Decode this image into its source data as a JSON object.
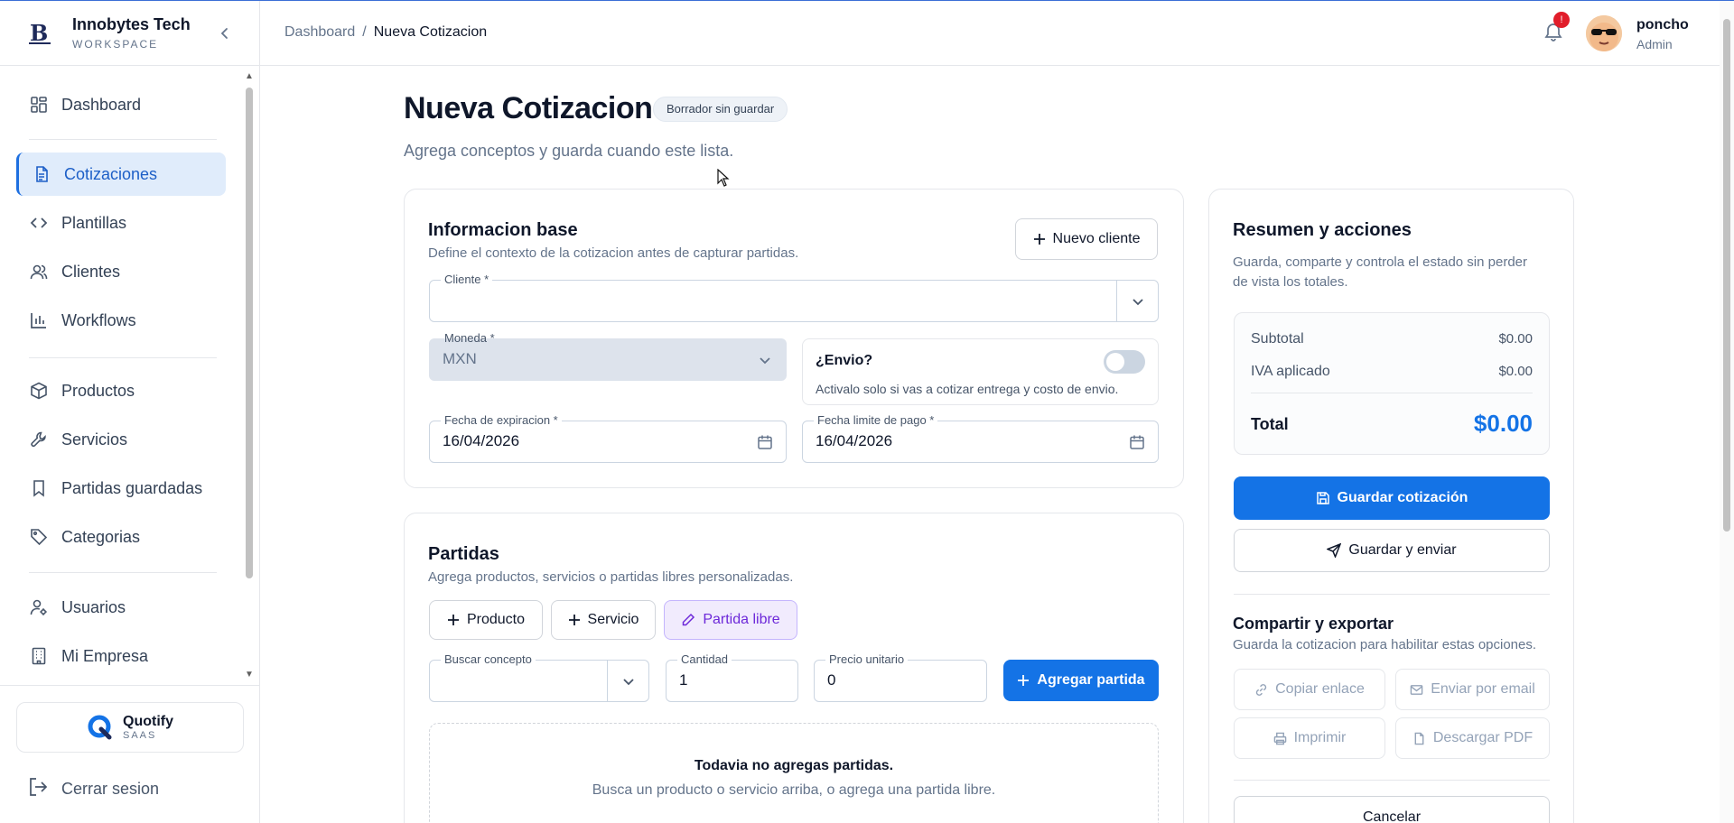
{
  "brand": {
    "name": "Innobytes Tech",
    "subtitle": "WORKSPACE"
  },
  "sidebar": {
    "items": [
      {
        "label": "Dashboard",
        "icon": "dashboard-icon"
      },
      {
        "label": "Cotizaciones",
        "icon": "document-icon",
        "active": true
      },
      {
        "label": "Plantillas",
        "icon": "code-icon"
      },
      {
        "label": "Clientes",
        "icon": "users-icon"
      },
      {
        "label": "Workflows",
        "icon": "chart-icon"
      },
      {
        "label": "Productos",
        "icon": "box-icon"
      },
      {
        "label": "Servicios",
        "icon": "wrench-icon"
      },
      {
        "label": "Partidas guardadas",
        "icon": "bookmark-icon"
      },
      {
        "label": "Categorias",
        "icon": "tag-icon"
      },
      {
        "label": "Usuarios",
        "icon": "user-gear-icon"
      },
      {
        "label": "Mi Empresa",
        "icon": "building-icon"
      }
    ],
    "product": {
      "name": "Quotify",
      "subtitle": "SAAS"
    },
    "logout": "Cerrar sesion"
  },
  "header": {
    "breadcrumb": {
      "root": "Dashboard",
      "separator": "/",
      "current": "Nueva Cotizacion"
    },
    "notifications": "!",
    "user": {
      "name": "poncho",
      "role": "Admin"
    }
  },
  "page": {
    "title": "Nueva Cotizacion",
    "badge": "Borrador sin guardar",
    "subtitle": "Agrega conceptos y guarda cuando este lista."
  },
  "base_info": {
    "title": "Informacion base",
    "subtitle": "Define el contexto de la cotizacion antes de capturar partidas.",
    "new_client_label": "Nuevo cliente",
    "client": {
      "label": "Cliente *",
      "value": ""
    },
    "currency": {
      "label": "Moneda *",
      "value": "MXN"
    },
    "shipping": {
      "label": "¿Envio?",
      "help": "Activalo solo si vas a cotizar entrega y costo de envio.",
      "enabled": false
    },
    "expiration": {
      "label": "Fecha de expiracion *",
      "value": "16/04/2026"
    },
    "payment_due": {
      "label": "Fecha limite de pago *",
      "value": "16/04/2026"
    }
  },
  "items": {
    "title": "Partidas",
    "subtitle": "Agrega productos, servicios o partidas libres personalizadas.",
    "add_product": "Producto",
    "add_service": "Servicio",
    "free_item": "Partida libre",
    "search": {
      "label": "Buscar concepto",
      "value": ""
    },
    "quantity": {
      "label": "Cantidad",
      "value": "1"
    },
    "unit_price": {
      "label": "Precio unitario",
      "value": "0"
    },
    "add_button": "Agregar partida",
    "empty_title": "Todavia no agregas partidas.",
    "empty_sub": "Busca un producto o servicio arriba, o agrega una partida libre."
  },
  "summary": {
    "title": "Resumen y acciones",
    "subtitle_line1": "Guarda, comparte y controla el estado sin perder",
    "subtitle_line2": "de vista los totales.",
    "subtotal_label": "Subtotal",
    "subtotal_value": "$0.00",
    "tax_label": "IVA aplicado",
    "tax_value": "$0.00",
    "total_label": "Total",
    "total_value": "$0.00",
    "save_label": "Guardar cotización",
    "save_send_label": "Guardar y enviar",
    "share_title": "Compartir y exportar",
    "share_sub": "Guarda la cotizacion para habilitar estas opciones.",
    "copy_link": "Copiar enlace",
    "send_email": "Enviar por email",
    "print": "Imprimir",
    "download_pdf": "Descargar PDF",
    "cancel": "Cancelar"
  },
  "colors": {
    "accent": "#1473e6",
    "active_bg": "#e0ecfb",
    "free_item_bg": "#f1ebfd",
    "free_item_text": "#6d28d9",
    "badge_red": "#e11d2a"
  }
}
